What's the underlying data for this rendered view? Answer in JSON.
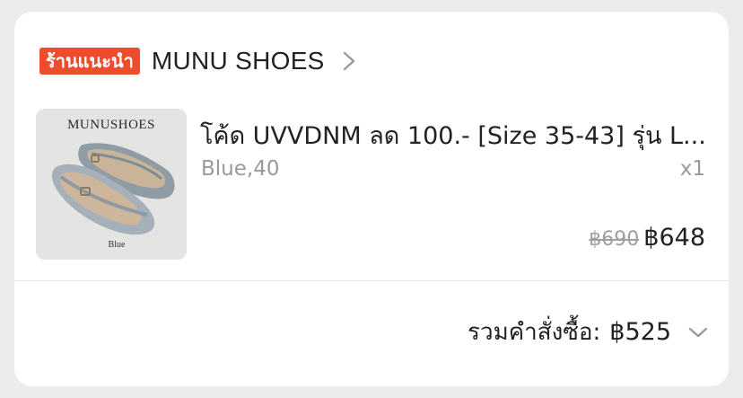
{
  "shop": {
    "badge": "ร้านแนะนำ",
    "name": "MUNU SHOES"
  },
  "product": {
    "image_brand": "MUNUSHOES",
    "image_caption": "Blue",
    "title": "โค้ด UVVDNM ลด 100.- [Size 35-43] รุ่น L...",
    "variant": "Blue,40",
    "quantity": "x1",
    "original_price": "฿690",
    "price": "฿648"
  },
  "order": {
    "total_label": "รวมคำสั่งซื้อ:",
    "total_value": "฿525"
  },
  "colors": {
    "badge_bg": "#ee4d2d",
    "text_primary": "#222222",
    "text_muted": "#9a9a9a"
  },
  "icons": {
    "shop_chevron": "chevron-right-icon",
    "total_chevron": "chevron-down-icon"
  }
}
